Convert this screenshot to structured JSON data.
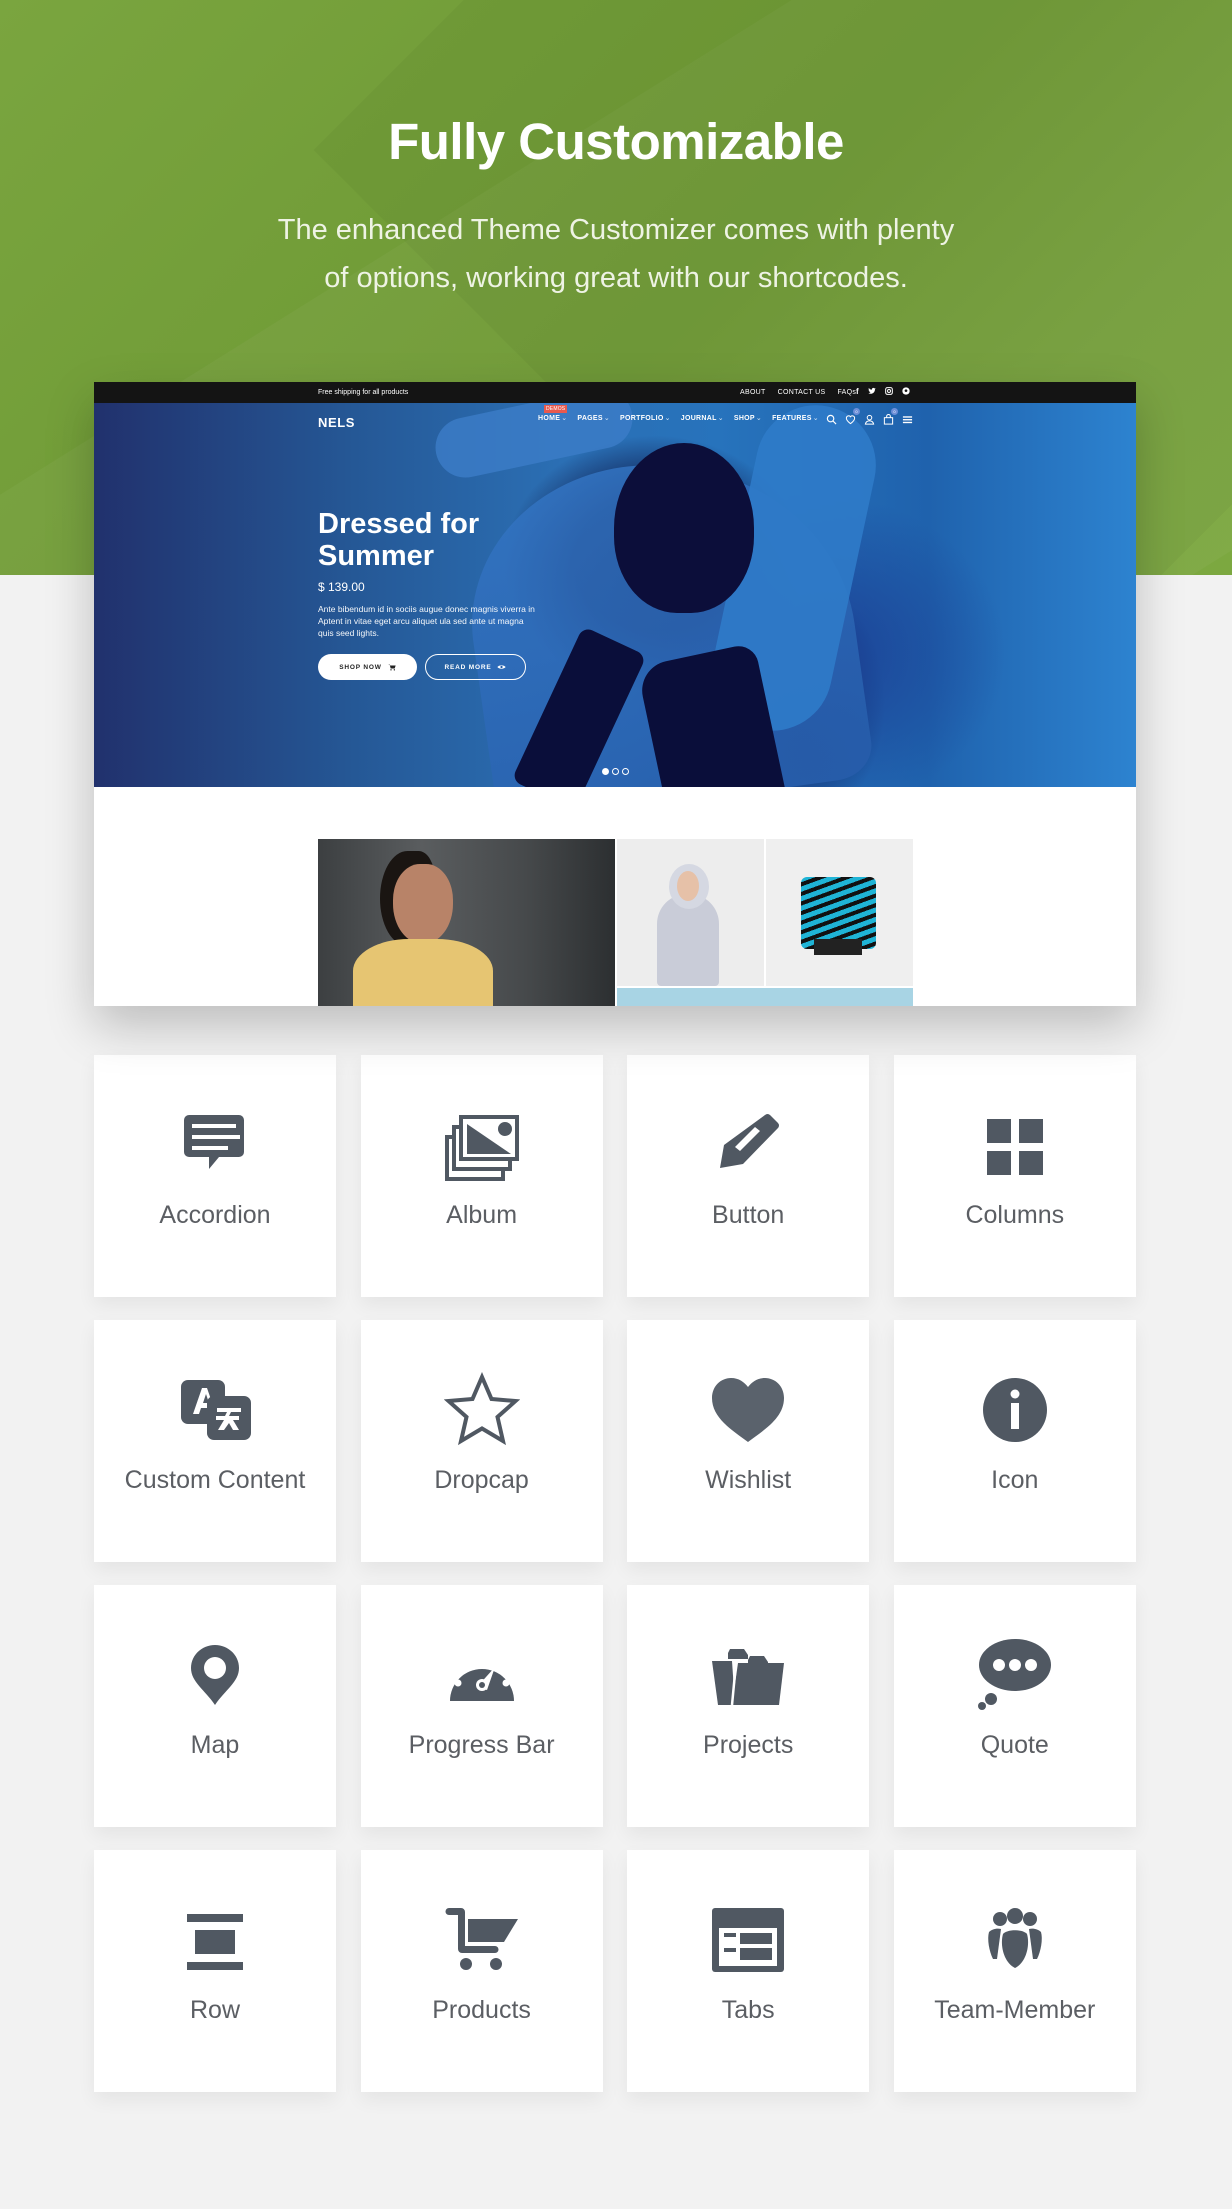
{
  "header": {
    "title": "Fully Customizable",
    "subtitle_line1": "The enhanced Theme Customizer comes with plenty",
    "subtitle_line2": "of options, working great with our shortcodes."
  },
  "mockup": {
    "topbar": {
      "shipping_text": "Free shipping for all products",
      "links": [
        "ABOUT",
        "CONTACT US",
        "FAQs"
      ],
      "social_icons": [
        "facebook-icon",
        "twitter-icon",
        "instagram-icon",
        "pinterest-icon"
      ]
    },
    "nav": {
      "logo": "NELS",
      "demos_badge": "DEMOS",
      "items": [
        {
          "label": "HOME"
        },
        {
          "label": "PAGES"
        },
        {
          "label": "PORTFOLIO"
        },
        {
          "label": "JOURNAL"
        },
        {
          "label": "SHOP"
        },
        {
          "label": "FEATURES"
        }
      ],
      "caret": "⌄",
      "wishlist_count": "0",
      "cart_count": "0"
    },
    "hero": {
      "title_line1": "Dressed for",
      "title_line2": "Summer",
      "price": "$ 139.00",
      "description": "Ante bibendum id in sociis augue donec magnis viverra in Aptent in vitae eget arcu aliquet ula sed ante ut magna quis seed lights.",
      "shop_now_label": "SHOP NOW",
      "read_more_label": "READ MORE",
      "slides_total": 3,
      "active_slide": 1
    }
  },
  "theme": {
    "accent_green": "#74a03a",
    "icon_color": "#505862",
    "label_color": "#5b5e63",
    "page_bg": "#f2f2f2"
  },
  "shortcodes": [
    {
      "label": "Accordion",
      "icon": "message-lines-icon"
    },
    {
      "label": "Album",
      "icon": "photo-album-icon"
    },
    {
      "label": "Button",
      "icon": "pencil-icon"
    },
    {
      "label": "Columns",
      "icon": "grid-icon"
    },
    {
      "label": "Custom Content",
      "icon": "translate-icon"
    },
    {
      "label": "Dropcap",
      "icon": "star-outline-icon"
    },
    {
      "label": "Wishlist",
      "icon": "heart-icon"
    },
    {
      "label": "Icon",
      "icon": "info-circle-icon"
    },
    {
      "label": "Map",
      "icon": "map-pin-icon"
    },
    {
      "label": "Progress Bar",
      "icon": "speedometer-icon"
    },
    {
      "label": "Projects",
      "icon": "folder-open-icon"
    },
    {
      "label": "Quote",
      "icon": "thought-bubble-icon"
    },
    {
      "label": "Row",
      "icon": "row-layout-icon"
    },
    {
      "label": "Products",
      "icon": "shopping-cart-icon"
    },
    {
      "label": "Tabs",
      "icon": "tabs-window-icon"
    },
    {
      "label": "Team-Member",
      "icon": "team-group-icon"
    }
  ]
}
